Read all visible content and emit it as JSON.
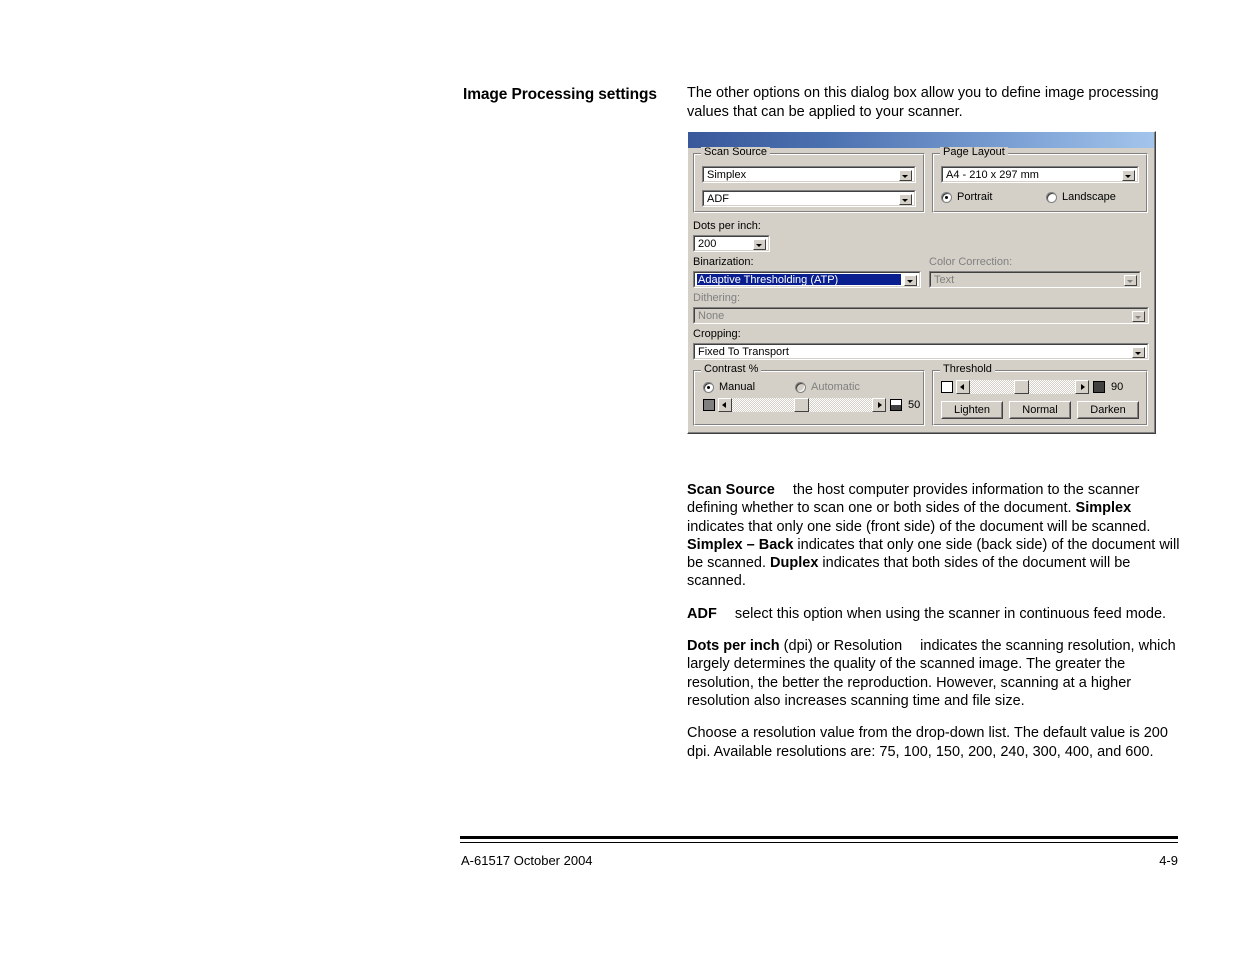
{
  "page": {
    "side_heading": "Image Processing settings",
    "intro": "The other options on this dialog box allow you to define image processing values that can be applied to your scanner."
  },
  "dialog": {
    "scan_source": {
      "group_title": "Scan Source",
      "source_value": "Simplex",
      "feeder_value": "ADF"
    },
    "page_layout": {
      "group_title": "Page Layout",
      "size_value": "A4 - 210 x 297 mm",
      "portrait_label": "Portrait",
      "landscape_label": "Landscape",
      "selected_orientation": "Portrait"
    },
    "dots_per_inch": {
      "label": "Dots per inch:",
      "value": "200"
    },
    "binarization": {
      "label": "Binarization:",
      "value": "Adaptive Thresholding (ATP)"
    },
    "color_correction": {
      "label": "Color Correction:",
      "value": "Text",
      "enabled": false
    },
    "dithering": {
      "label": "Dithering:",
      "value": "None",
      "enabled": false
    },
    "cropping": {
      "label": "Cropping:",
      "value": "Fixed To Transport"
    },
    "contrast": {
      "group_title": "Contrast %",
      "manual_label": "Manual",
      "automatic_label": "Automatic",
      "selected_mode": "Manual",
      "value": "50"
    },
    "threshold": {
      "group_title": "Threshold",
      "value": "90",
      "lighten_label": "Lighten",
      "normal_label": "Normal",
      "darken_label": "Darken"
    }
  },
  "body": {
    "p_scan_source": {
      "term": "Scan Source",
      "text_1": "the host computer provides information to the scanner defining whether to scan one or both sides of the document. ",
      "b_1": "Simplex",
      "text_2": " indicates that only one side (front side) of the document will be scanned. ",
      "b_2": "Simplex – Back",
      "text_3": " indicates that only one side (back side) of the document will be scanned. ",
      "b_3": "Duplex",
      "text_4": " indicates that both sides of the document will be scanned."
    },
    "p_adf": {
      "term": "ADF",
      "text_1": "select this option when using the scanner in continuous feed mode."
    },
    "p_dpi": {
      "term": "Dots per inch",
      "text_1": " (dpi) or Resolution",
      "text_2": "indicates the scanning resolution, which largely determines the quality of the scanned image. The greater the resolution, the better the reproduction. However, scanning at a higher resolution also increases scanning time and file size."
    },
    "p_choose": {
      "text_1": "Choose a resolution value from the drop-down list. The default value is 200 dpi. Available resolutions are: 75, 100, 150, 200, 240, 300, 400, and 600."
    }
  },
  "footer": {
    "left": "A-61517 October 2004",
    "right": "4-9"
  },
  "colors": {
    "titlebar_start": "#39589b",
    "titlebar_end": "#a3c5ec",
    "dialog_face": "#d4d0c8",
    "selection_blue": "#0a1f8f"
  }
}
